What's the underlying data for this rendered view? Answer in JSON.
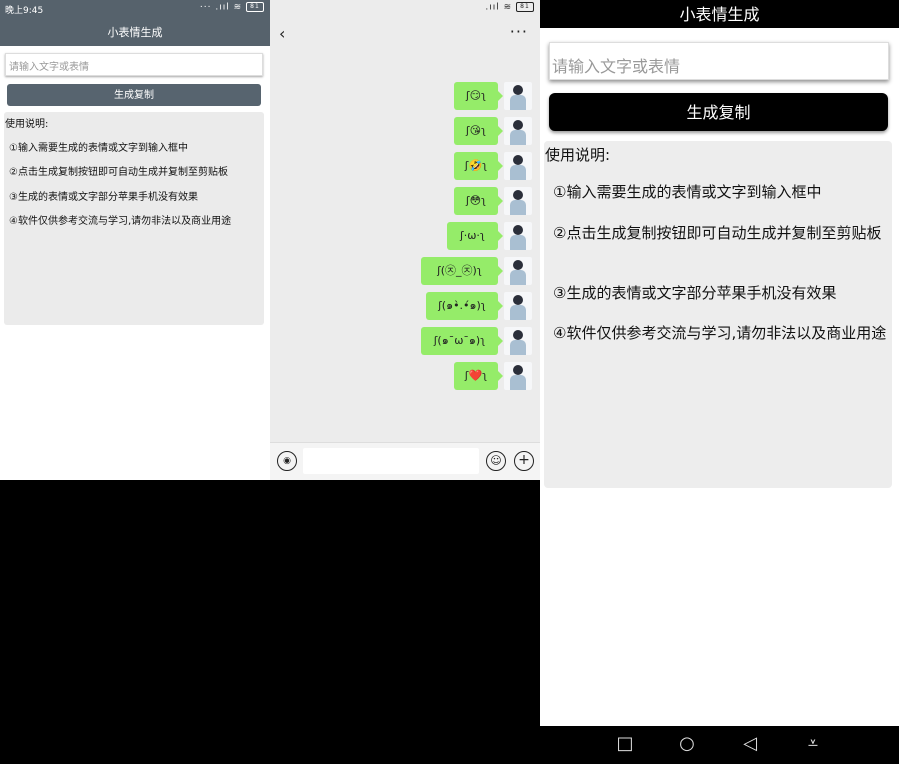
{
  "panel1": {
    "status_time": "晚上9:45",
    "status_icons": "··· .ııl ≋",
    "battery": "81",
    "title": "小表情生成",
    "input_placeholder": "请输入文字或表情",
    "button_label": "生成复制",
    "instructions_header": "使用说明:",
    "instructions": [
      "①输入需要生成的表情或文字到输入框中",
      "②点击生成复制按钮即可自动生成并复制至剪贴板",
      "③生成的表情或文字部分苹果手机没有效果",
      "④软件仅供参考交流与学习,请勿非法以及商业用途"
    ]
  },
  "panel2": {
    "status_icons": ".ııl ≋",
    "battery": "81",
    "back_icon": "‹",
    "more_icon": "···",
    "messages": [
      {
        "text": "ʃ😏ʅ"
      },
      {
        "text": "ʃ😘ʅ"
      },
      {
        "text": "ʃ🤣ʅ"
      },
      {
        "text": "ʃ😳ʅ"
      },
      {
        "text": "ʃ·ω·ʅ"
      },
      {
        "text": "ʃ(㉨_㉨)ʅ"
      },
      {
        "text": "ʃ(๑•̀.•́๑)ʅ"
      },
      {
        "text": "ʃ(๑¯ω¯๑)ʅ"
      },
      {
        "text": "ʃ❤️ʅ"
      }
    ],
    "voice_icon": "◉",
    "emoji_icon": "☺",
    "plus_icon": "+"
  },
  "panel3": {
    "title": "小表情生成",
    "input_placeholder": "请输入文字或表情",
    "button_label": "生成复制",
    "instructions_header": "使用说明:",
    "instructions": [
      "①输入需要生成的表情或文字到输入框中",
      "②点击生成复制按钮即可自动生成并复制至剪贴板",
      "③生成的表情或文字部分苹果手机没有效果",
      "④软件仅供参考交流与学习,请勿非法以及商业用途"
    ],
    "nav": {
      "recents": "□",
      "home": "○",
      "back": "◁",
      "menu": "⩡"
    }
  }
}
